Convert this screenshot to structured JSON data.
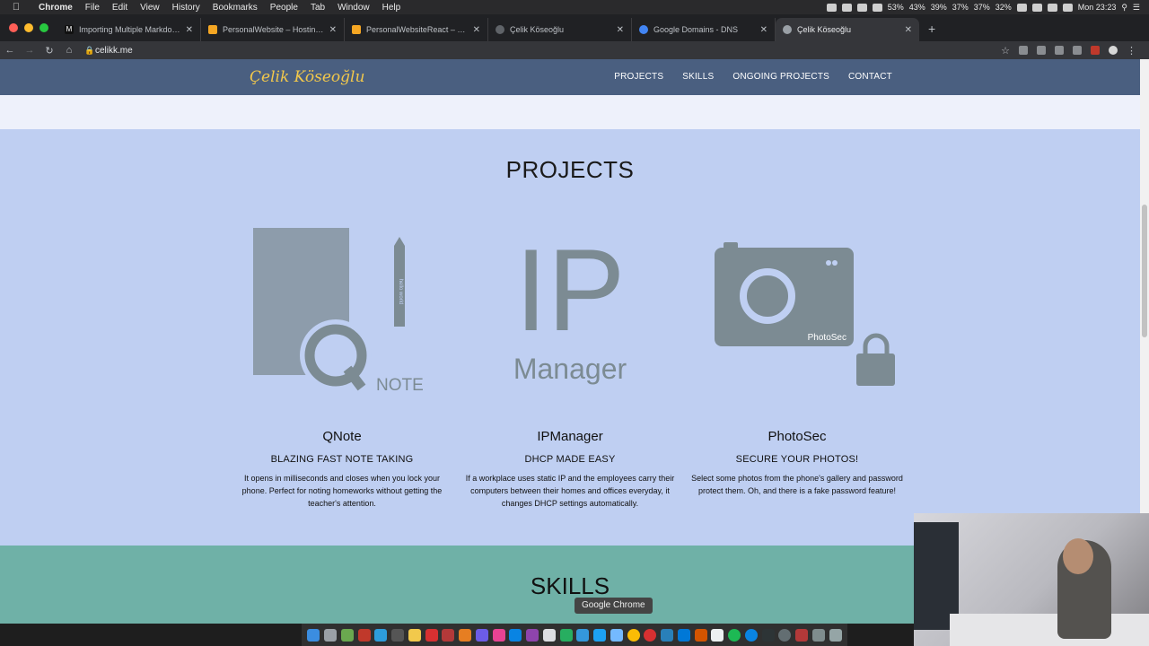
{
  "menubar": {
    "app": "Chrome",
    "items": [
      "File",
      "Edit",
      "View",
      "History",
      "Bookmarks",
      "People",
      "Tab",
      "Window",
      "Help"
    ],
    "stats": [
      "53%",
      "43%",
      "39%",
      "37%",
      "37%",
      "32%"
    ],
    "clock": "Mon 23:23"
  },
  "tabs": [
    {
      "title": "Importing Multiple Markdown f",
      "icon": "medium-icon",
      "active": false
    },
    {
      "title": "PersonalWebsite – Hosting – Fi",
      "icon": "firebase-icon",
      "active": false
    },
    {
      "title": "PersonalWebsiteReact – Hostin",
      "icon": "firebase-icon",
      "active": false
    },
    {
      "title": "Çelik Köseoğlu",
      "icon": "globe-icon",
      "active": false
    },
    {
      "title": "Google Domains - DNS",
      "icon": "google-domains-icon",
      "active": false
    },
    {
      "title": "Çelik Köseoğlu",
      "icon": "globe-icon",
      "active": true
    }
  ],
  "toolbar": {
    "url": "celikk.me"
  },
  "site": {
    "logo": "Çelik Köseoğlu",
    "nav": [
      "PROJECTS",
      "SKILLS",
      "ONGOING PROJECTS",
      "CONTACT"
    ],
    "projects_heading": "PROJECTS",
    "projects": [
      {
        "name": "QNote",
        "tagline": "BLAZING FAST NOTE TAKING",
        "description": "It opens in milliseconds and closes when you lock your phone. Perfect for noting homeworks without getting the teacher's attention.",
        "art_word": "NOTE",
        "art_pen_text": "hello world"
      },
      {
        "name": "IPManager",
        "tagline": "DHCP MADE EASY",
        "description": "If a workplace uses static IP and the employees carry their computers between their homes and offices everyday, it changes DHCP settings automatically.",
        "art_big": "IP",
        "art_word": "Manager"
      },
      {
        "name": "PhotoSec",
        "tagline": "SECURE YOUR PHOTOS!",
        "description": "Select some photos from the phone's gallery and password protect them. Oh, and there is a fake password feature!",
        "art_word": "PhotoSec"
      }
    ],
    "skills_heading": "SKILLS"
  },
  "tooltip": "Google Chrome",
  "colors": {
    "nav_bg": "#4a5f80",
    "logo": "#f2c84b",
    "projects_bg": "#bfcff2",
    "skills_bg": "#6fb1a7",
    "art_gray": "#7c8b93"
  }
}
